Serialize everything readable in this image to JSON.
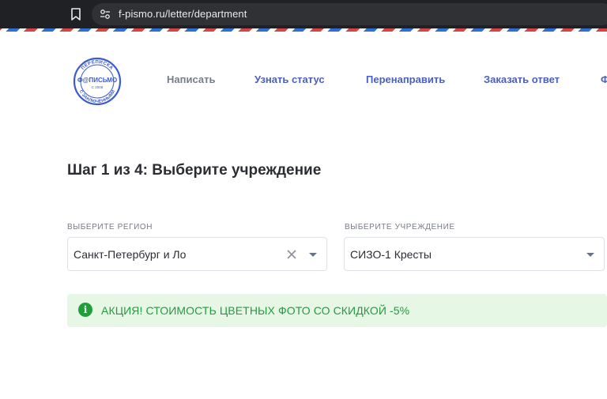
{
  "browser": {
    "url": "f-pismo.ru/letter/department"
  },
  "header": {
    "logo": {
      "ring_top": "ПЕРЕПИСКА",
      "center": "Ф@ПИСЬМО",
      "year": "С 2008",
      "ring_bottom": "С ЗАКЛЮЧЁННЫМИ"
    },
    "nav": {
      "write": "Написать",
      "status": "Узнать статус",
      "redirect": "Перенаправить",
      "reply": "Заказать ответ",
      "more": "Ф"
    }
  },
  "step": {
    "title": "Шаг 1 из 4: Выберите учреждение"
  },
  "region_select": {
    "label": "ВЫБЕРИТЕ РЕГИОН",
    "value": "Санкт-Петербург и Ло"
  },
  "institution_select": {
    "label": "ВЫБЕРИТЕ УЧРЕЖДЕНИЕ",
    "value": "СИЗО-1 Кресты"
  },
  "promo": {
    "icon": "info-icon",
    "text": "АКЦИЯ! СТОИМОСТЬ ЦВЕТНЫХ ФОТО СО СКИДКОЙ -5%"
  },
  "colors": {
    "nav_link": "#4a5fc1",
    "promo_bg": "#e7f7e6",
    "promo_text": "#239a3f",
    "stripe_red": "#d64545",
    "stripe_blue": "#2f6fd1"
  }
}
